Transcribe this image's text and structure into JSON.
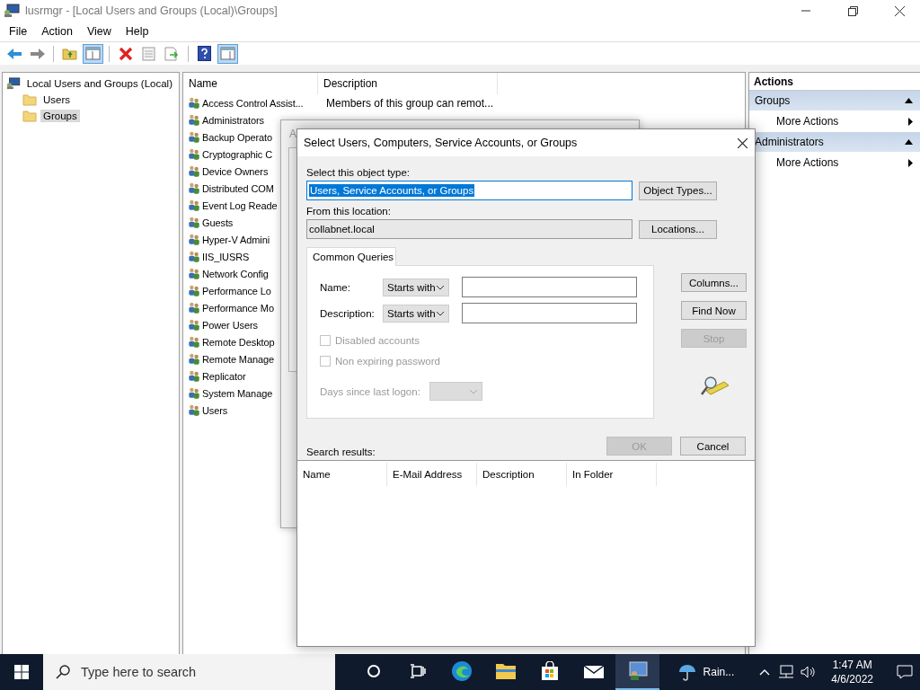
{
  "window": {
    "title": "lusrmgr - [Local Users and Groups (Local)\\Groups]"
  },
  "menu": [
    "File",
    "Action",
    "View",
    "Help"
  ],
  "toolbar": [
    {
      "kind": "back",
      "pressed": false
    },
    {
      "kind": "forward",
      "pressed": false
    },
    {
      "kind": "sep"
    },
    {
      "kind": "up",
      "pressed": false
    },
    {
      "kind": "tree",
      "pressed": true
    },
    {
      "kind": "sep"
    },
    {
      "kind": "delete",
      "pressed": false
    },
    {
      "kind": "properties",
      "pressed": false
    },
    {
      "kind": "export",
      "pressed": false
    },
    {
      "kind": "sep"
    },
    {
      "kind": "help",
      "pressed": false
    },
    {
      "kind": "actionpane",
      "pressed": true
    }
  ],
  "tree": {
    "label": "Local Users and Groups (Local)",
    "children": [
      {
        "label": "Users",
        "selected": false
      },
      {
        "label": "Groups",
        "selected": true
      }
    ]
  },
  "list": {
    "columns": [
      "Name",
      "Description"
    ],
    "rows": [
      {
        "name": "Access Control Assist...",
        "description": "Members of this group can remot..."
      },
      {
        "name": "Administrators",
        "description": ""
      },
      {
        "name": "Backup Operato",
        "description": ""
      },
      {
        "name": "Cryptographic C",
        "description": ""
      },
      {
        "name": "Device Owners",
        "description": ""
      },
      {
        "name": "Distributed COM",
        "description": ""
      },
      {
        "name": "Event Log Reade",
        "description": ""
      },
      {
        "name": "Guests",
        "description": ""
      },
      {
        "name": "Hyper-V Admini",
        "description": ""
      },
      {
        "name": "IIS_IUSRS",
        "description": ""
      },
      {
        "name": "Network Config",
        "description": ""
      },
      {
        "name": "Performance Lo",
        "description": ""
      },
      {
        "name": "Performance Mo",
        "description": ""
      },
      {
        "name": "Power Users",
        "description": ""
      },
      {
        "name": "Remote Desktop",
        "description": ""
      },
      {
        "name": "Remote Manage",
        "description": ""
      },
      {
        "name": "Replicator",
        "description": ""
      },
      {
        "name": "System Manage",
        "description": ""
      },
      {
        "name": "Users",
        "description": ""
      }
    ]
  },
  "actions": {
    "title": "Actions",
    "sections": [
      {
        "title": "Groups",
        "items": [
          "More Actions"
        ]
      },
      {
        "title": "Administrators",
        "items": [
          "More Actions"
        ]
      }
    ]
  },
  "back_dialog": {
    "title": "A"
  },
  "dialog": {
    "title": "Select Users, Computers, Service Accounts, or Groups",
    "object_type_label": "Select this object type:",
    "object_type": "Users, Service Accounts, or Groups",
    "object_types_button": "Object Types...",
    "location_label": "From this location:",
    "location": "collabnet.local",
    "locations_button": "Locations...",
    "tab": "Common Queries",
    "queries": [
      {
        "label": "Name:",
        "operator": "Starts with"
      },
      {
        "label": "Description:",
        "operator": "Starts with"
      }
    ],
    "checkboxes": [
      {
        "label": "Disabled accounts",
        "checked": false,
        "disabled": true
      },
      {
        "label": "Non expiring password",
        "checked": false,
        "disabled": true
      }
    ],
    "days_label": "Days since last logon:",
    "side_buttons": [
      {
        "label": "Columns...",
        "disabled": false
      },
      {
        "label": "Find Now",
        "disabled": false
      },
      {
        "label": "Stop",
        "disabled": true
      }
    ],
    "ok": {
      "label": "OK",
      "disabled": true
    },
    "cancel": {
      "label": "Cancel",
      "disabled": false
    },
    "results_label": "Search results:",
    "result_columns": [
      "Name",
      "E-Mail Address",
      "Description",
      "In Folder"
    ]
  },
  "taskbar": {
    "search_placeholder": "Type here to search",
    "apps": [
      {
        "kind": "cortana",
        "active": false
      },
      {
        "kind": "taskview",
        "active": false
      },
      {
        "kind": "edge",
        "active": false
      },
      {
        "kind": "explorer",
        "active": false
      },
      {
        "kind": "store",
        "active": false
      },
      {
        "kind": "mail",
        "active": false
      },
      {
        "kind": "mmc",
        "active": true
      }
    ],
    "weather": "Rain...",
    "time": "1:47 AM",
    "date": "4/6/2022"
  }
}
